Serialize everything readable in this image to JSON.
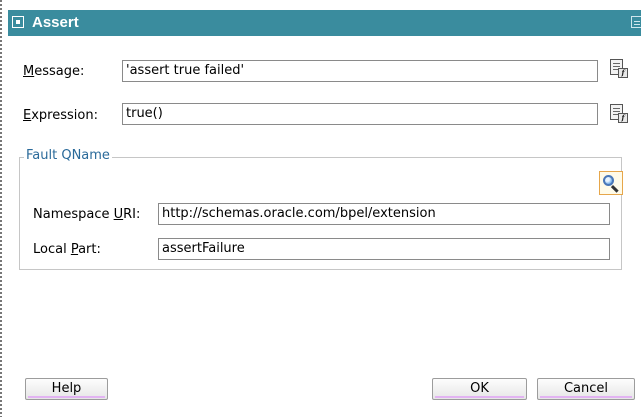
{
  "window": {
    "title": "Assert"
  },
  "form": {
    "message_label_key": "M",
    "message_label_rest": "essage:",
    "message_value": "'assert true failed'",
    "expression_label_key": "E",
    "expression_label_rest": "xpression:",
    "expression_value": "true()"
  },
  "fault_qname": {
    "group_title": "Fault QName",
    "namespace_label_pre": "Namespace ",
    "namespace_label_key": "U",
    "namespace_label_post": "RI:",
    "namespace_value": "http://schemas.oracle.com/bpel/extension",
    "local_part_label_pre": "Local ",
    "local_part_label_key": "P",
    "local_part_label_post": "art:",
    "local_part_value": "assertFailure"
  },
  "buttons": {
    "help": "Help",
    "ok": "OK",
    "cancel": "Cancel"
  },
  "icons": {
    "window": "window-icon",
    "expression_builder": "expression-builder-icon",
    "search": "search-icon"
  },
  "colors": {
    "titlebar": "#3a8c9e",
    "group_title": "#2a6a9a",
    "button_accent": "#e2b3f2"
  }
}
